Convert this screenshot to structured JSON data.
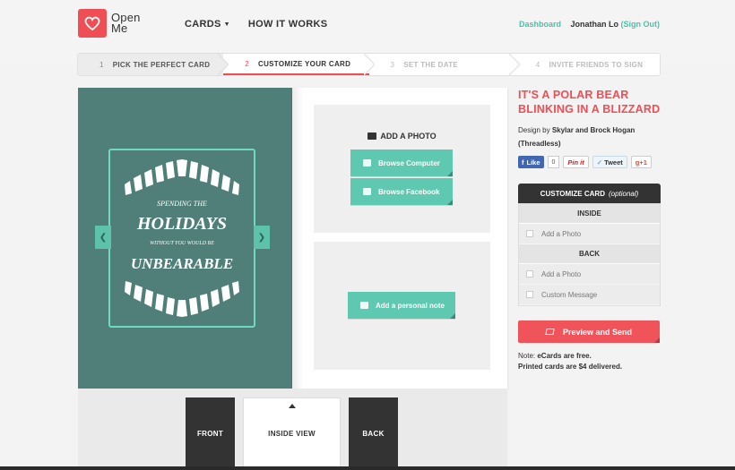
{
  "header": {
    "logo_line1": "Open",
    "logo_line2": "Me",
    "nav": [
      {
        "label": "CARDS"
      },
      {
        "label": "HOW IT WORKS"
      }
    ],
    "dashboard": "Dashboard",
    "user_name": "Jonathan Lo",
    "sign_out": "(Sign Out)"
  },
  "steps": [
    {
      "num": "1",
      "label": "PICK THE PERFECT CARD",
      "state": "done"
    },
    {
      "num": "2",
      "label": "CUSTOMIZE YOUR CARD",
      "state": "active"
    },
    {
      "num": "3",
      "label": "SET THE DATE",
      "state": "future"
    },
    {
      "num": "4",
      "label": "INVITE FRIENDS TO SIGN",
      "state": "future"
    }
  ],
  "card_art": {
    "line1": "SPENDING THE",
    "line2": "HOLIDAYS",
    "line3": "WITHOUT YOU WOULD BE",
    "line4": "UNBEARABLE"
  },
  "inside": {
    "add_photo_title": "ADD A PHOTO",
    "browse_computer": "Browse Computer",
    "browse_facebook": "Browse Facebook",
    "add_note": "Add a personal note"
  },
  "view_tabs": {
    "front": "FRONT",
    "inside": "INSIDE VIEW",
    "back": "BACK"
  },
  "details": {
    "title": "IT'S A POLAR BEAR BLINKING IN A BLIZZARD",
    "design_by_prefix": "Design by",
    "designers": "Skylar and Brock Hogan (Threadless)",
    "social": {
      "like": "Like",
      "like_count": "0",
      "pin": "Pin it",
      "tweet": "Tweet",
      "gplus": "g+1"
    }
  },
  "customize": {
    "title": "CUSTOMIZE CARD",
    "optional": "(optional)",
    "inside_label": "INSIDE",
    "inside_add_photo": "Add a Photo",
    "back_label": "BACK",
    "back_add_photo": "Add a Photo",
    "custom_message": "Custom Message"
  },
  "preview_button": "Preview and Send",
  "note": {
    "prefix": "Note:",
    "line1": "eCards are free.",
    "line2": "Printed cards are $4 delivered."
  },
  "colors": {
    "brand_red": "#ef4e54",
    "teal": "#5fc8b0",
    "card_green": "#4f7f78"
  }
}
